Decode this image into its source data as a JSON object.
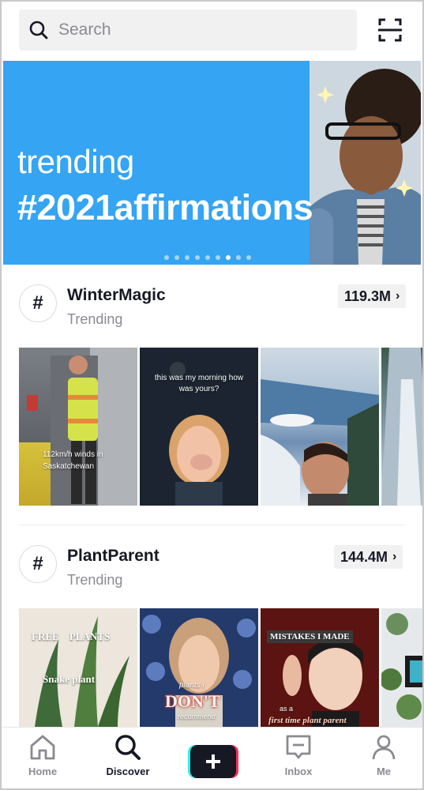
{
  "search": {
    "placeholder": "Search"
  },
  "banner": {
    "line1": "trending",
    "line2": "#2021affirmations",
    "dots_total": 9,
    "active_dot": 6,
    "color": "#35a4f3"
  },
  "hashtags": [
    {
      "name": "WinterMagic",
      "subtitle": "Trending",
      "count": "119.3M",
      "thumbs": [
        {
          "caption": "112km/h winds in Saskatchewan"
        },
        {
          "caption": "this was my morning how was yours?"
        },
        {
          "caption": ""
        },
        {
          "caption": ""
        }
      ]
    },
    {
      "name": "PlantParent",
      "subtitle": "Trending",
      "count": "144.4M",
      "thumbs": [
        {
          "caption": "FREE PLANTS",
          "caption2": "Snake plant"
        },
        {
          "caption": "plants i",
          "caption2": "DON'T",
          "caption3": "recommend"
        },
        {
          "caption": "MISTAKES I MADE",
          "caption2": "as a",
          "caption3": "first time plant parent"
        },
        {
          "caption": ""
        }
      ]
    }
  ],
  "nav": {
    "home": "Home",
    "discover": "Discover",
    "inbox": "Inbox",
    "me": "Me",
    "active": "discover"
  }
}
